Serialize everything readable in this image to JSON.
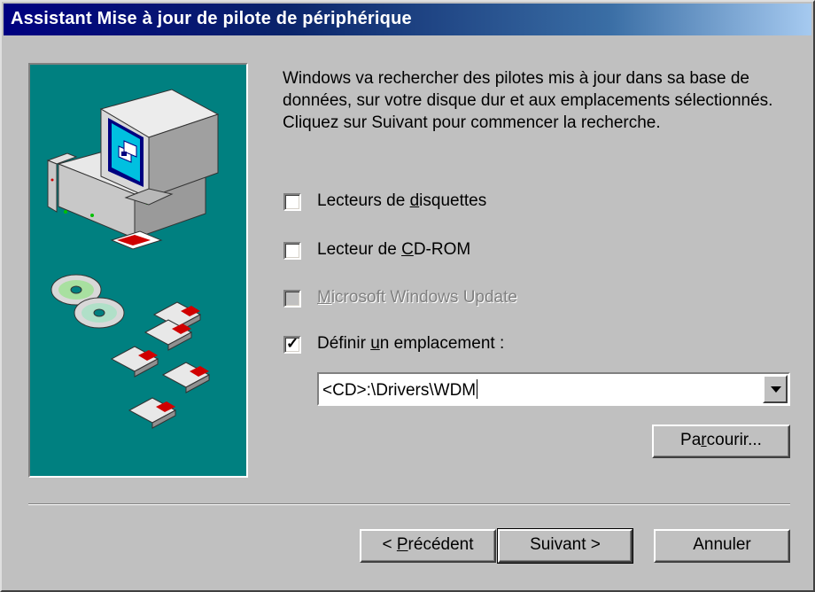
{
  "window": {
    "title": "Assistant Mise à jour de pilote de périphérique"
  },
  "intro_text": "Windows va rechercher des pilotes mis à jour dans sa base de données, sur votre disque dur et aux emplacements sélectionnés. Cliquez sur Suivant pour commencer la recherche.",
  "options": [
    {
      "pre": "Lecteurs de ",
      "mnemonic": "d",
      "post": "isquettes",
      "checked": false,
      "enabled": true
    },
    {
      "pre": "Lecteur de ",
      "mnemonic": "C",
      "post": "D-ROM",
      "checked": false,
      "enabled": true
    },
    {
      "pre": "",
      "mnemonic": "M",
      "post": "icrosoft Windows Update",
      "checked": false,
      "enabled": false
    },
    {
      "pre": "Définir ",
      "mnemonic": "u",
      "post": "n emplacement :",
      "checked": true,
      "enabled": true
    }
  ],
  "location": {
    "value": "<CD>:\\Drivers\\WDM"
  },
  "buttons": {
    "browse": {
      "pre": "Pa",
      "mnemonic": "r",
      "post": "courir..."
    },
    "back": {
      "pre": "< ",
      "mnemonic": "P",
      "post": "récédent"
    },
    "next": "Suivant >",
    "cancel": "Annuler"
  },
  "icons": [
    "computer-icon",
    "cd-icon",
    "floppy-disk-icon",
    "checkmark-icon",
    "dropdown-arrow-icon"
  ],
  "colors": {
    "title_start": "#000080",
    "title_end": "#a6caf0",
    "art_bg": "#008080",
    "face": "#c0c0c0"
  }
}
